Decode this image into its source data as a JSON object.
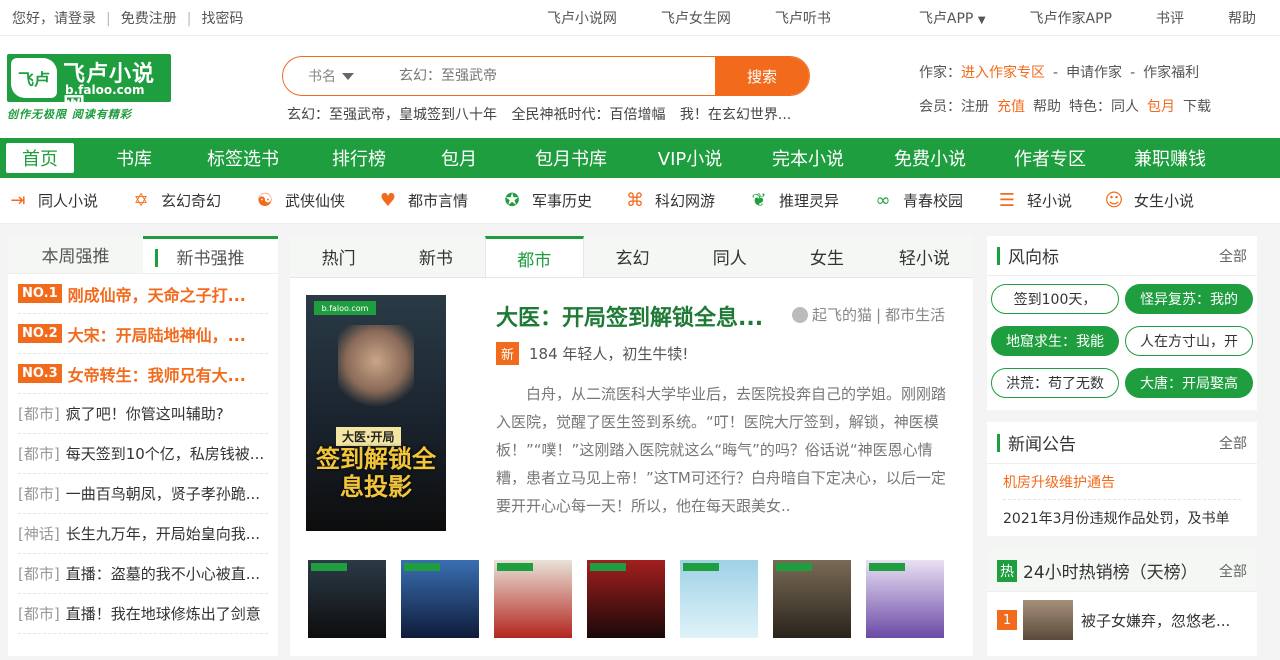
{
  "topbar": {
    "greeting": "您好，请登录",
    "register": "免费注册",
    "find_pwd": "找密码",
    "links": [
      "飞卢小说网",
      "飞卢女生网",
      "飞卢听书",
      "飞卢APP",
      "飞卢作家APP",
      "书评",
      "帮助"
    ]
  },
  "logo": {
    "name": "飞卢小说网",
    "domain": "b.faloo.com",
    "slogan": "创作无极限  阅读有精彩",
    "mark": "飞卢"
  },
  "search": {
    "category": "书名",
    "placeholder": "玄幻：至强武帝",
    "button": "搜索"
  },
  "hotwords": [
    "玄幻：至强武帝，皇城签到八十年",
    "全民神祇时代：百倍增幅",
    "我！在玄幻世界..."
  ],
  "header_info": {
    "author_label": "作家：",
    "author_links": [
      "进入作家专区",
      "申请作家",
      "作家福利"
    ],
    "member_label": "会员：",
    "member_links": [
      "注册",
      "充值",
      "帮助"
    ],
    "feature_label": "特色：",
    "feature_links": [
      "同人",
      "包月",
      "下载"
    ]
  },
  "nav": [
    "首页",
    "书库",
    "标签选书",
    "排行榜",
    "包月",
    "包月书库",
    "VIP小说",
    "完本小说",
    "免费小说",
    "作者专区",
    "兼职赚钱"
  ],
  "categories": [
    {
      "label": "同人小说",
      "icon": "book-arrow-icon"
    },
    {
      "label": "玄幻奇幻",
      "icon": "star-of-david-icon"
    },
    {
      "label": "武侠仙侠",
      "icon": "yin-yang-icon"
    },
    {
      "label": "都市言情",
      "icon": "heart-icon"
    },
    {
      "label": "军事历史",
      "icon": "military-badge-icon"
    },
    {
      "label": "科幻网游",
      "icon": "gamepad-icon"
    },
    {
      "label": "推理灵异",
      "icon": "leaf-icon"
    },
    {
      "label": "青春校园",
      "icon": "ring-icon"
    },
    {
      "label": "轻小说",
      "icon": "list-icon"
    },
    {
      "label": "女生小说",
      "icon": "girl-icon"
    }
  ],
  "left_tabs": [
    "本周强推",
    "新书强推"
  ],
  "left_rank": [
    {
      "badge": "NO.1",
      "title": "刚成仙帝，天命之子打..."
    },
    {
      "badge": "NO.2",
      "title": "大宋：开局陆地神仙，..."
    },
    {
      "badge": "NO.3",
      "title": "女帝转生：我师兄有大..."
    },
    {
      "tag": "[都市]",
      "title": "疯了吧！你管这叫辅助?"
    },
    {
      "tag": "[都市]",
      "title": "每天签到10个亿，私房钱被..."
    },
    {
      "tag": "[都市]",
      "title": "一曲百鸟朝凤，贤子孝孙跪..."
    },
    {
      "tag": "[神话]",
      "title": "长生九万年，开局始皇向我..."
    },
    {
      "tag": "[都市]",
      "title": "直播：盗墓的我不小心被直..."
    },
    {
      "tag": "[都市]",
      "title": "直播！我在地球修炼出了剑意"
    }
  ],
  "center_tabs": [
    "热门",
    "新书",
    "都市",
    "玄幻",
    "同人",
    "女生",
    "轻小说"
  ],
  "featured": {
    "title": "大医：开局签到解锁全息...",
    "author": "起飞的猫",
    "genre": "都市生活",
    "new_badge": "新",
    "latest": "184 年轻人，初生牛犊!",
    "desc": "白舟，从二流医科大学毕业后，去医院投奔自己的学姐。刚刚踏入医院，觉醒了医生签到系统。“叮！医院大厅签到，解锁，神医模板！”“噗！”这刚踏入医院就这么“晦气”的吗？俗话说“神医恩心情糟，患者立马见上帝！”这TM可还行？白舟暗自下定决心，以后一定要开开心心每一天！所以，他在每天跟美女..",
    "cover_text": "签到解锁全息投影",
    "cover_sub": "大医·开局",
    "cover_logo": "b.faloo.com"
  },
  "thumbs": [
    {
      "color1": "#2b3a46",
      "color2": "#0d0d0d"
    },
    {
      "color1": "#3a6fb3",
      "color2": "#0f1c3a"
    },
    {
      "color1": "#e8e2d8",
      "color2": "#b3261e"
    },
    {
      "color1": "#a31f1f",
      "color2": "#1a0808"
    },
    {
      "color1": "#9fd1e6",
      "color2": "#dff3f9"
    },
    {
      "color1": "#7a6a55",
      "color2": "#2a241c"
    },
    {
      "color1": "#e9e0f4",
      "color2": "#6b4aa6"
    }
  ],
  "trend": {
    "title": "风向标",
    "all": "全部",
    "pills": [
      {
        "text": "签到100天，",
        "style": "w"
      },
      {
        "text": "怪异复苏：我的",
        "style": "g"
      },
      {
        "text": "地窟求生：我能",
        "style": "g"
      },
      {
        "text": "人在方寸山，开",
        "style": "w"
      },
      {
        "text": "洪荒：苟了无数",
        "style": "w"
      },
      {
        "text": "大唐：开局娶高",
        "style": "g"
      }
    ]
  },
  "news": {
    "title": "新闻公告",
    "all": "全部",
    "items": [
      "机房升级维护通告",
      "2021年3月份违规作品处罚，及书单"
    ]
  },
  "hot24": {
    "badge": "热",
    "title": "24小时热销榜（天榜）",
    "all": "全部",
    "first_rank": "1",
    "first_title": "被子女嫌弃，忽悠老..."
  },
  "colors": {
    "brand": "#1e9e3e",
    "accent": "#f26b1d"
  }
}
